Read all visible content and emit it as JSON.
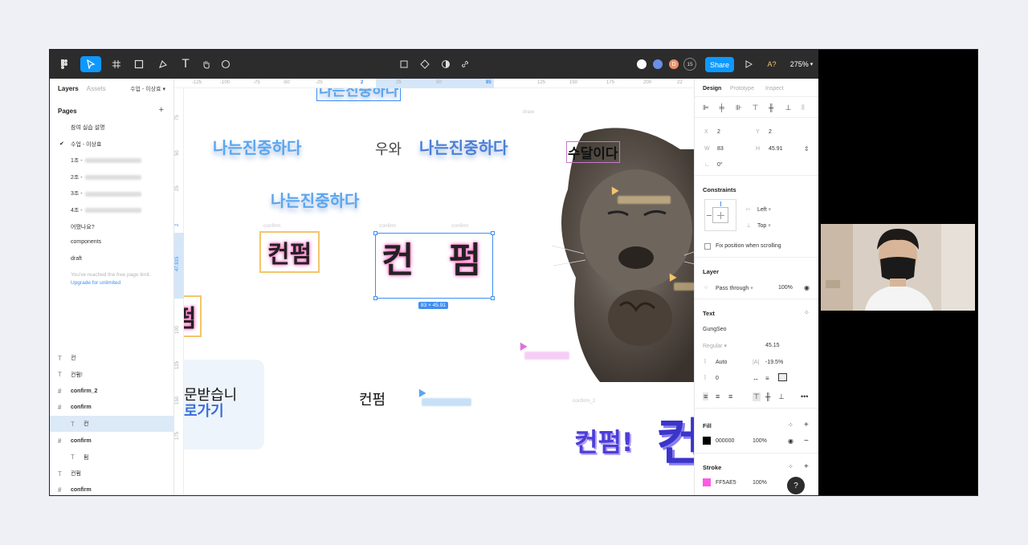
{
  "toolbar": {
    "zoom": "275%",
    "share_label": "Share",
    "ai_label": "A?",
    "collaborator_count": "15",
    "avatar_letter": "D"
  },
  "left_panel": {
    "tab_layers": "Layers",
    "tab_assets": "Assets",
    "current_page": "수업 - 이상효",
    "pages_heading": "Pages",
    "add_icon": "+",
    "pages": [
      {
        "label": "참여 실습 설명",
        "active": false
      },
      {
        "label": "수업 - 이상효",
        "active": true
      },
      {
        "label": "1조 -",
        "active": false
      },
      {
        "label": "2조 -",
        "active": false
      },
      {
        "label": "3조 -",
        "active": false
      },
      {
        "label": "4조 -",
        "active": false
      },
      {
        "label": "어땠나요?",
        "active": false
      },
      {
        "label": "components",
        "active": false
      },
      {
        "label": "draft",
        "active": false
      }
    ],
    "limit_note": "You've reached the free page limit.",
    "upgrade_link": "Upgrade for unlimited",
    "layers": [
      {
        "icon": "T",
        "label": "컨",
        "bold": false,
        "selected": false,
        "indent": false
      },
      {
        "icon": "T",
        "label": "컨펌!",
        "bold": false,
        "selected": false,
        "indent": false
      },
      {
        "icon": "#",
        "label": "confirm_2",
        "bold": true,
        "selected": false,
        "indent": false
      },
      {
        "icon": "#",
        "label": "confirm",
        "bold": true,
        "selected": false,
        "indent": false
      },
      {
        "icon": "T",
        "label": "컨",
        "bold": false,
        "selected": true,
        "indent": true
      },
      {
        "icon": "#",
        "label": "confirm",
        "bold": true,
        "selected": false,
        "indent": false
      },
      {
        "icon": "T",
        "label": "펌",
        "bold": false,
        "selected": false,
        "indent": true
      },
      {
        "icon": "T",
        "label": "컨펌",
        "bold": false,
        "selected": false,
        "indent": false
      },
      {
        "icon": "#",
        "label": "confirm",
        "bold": true,
        "selected": false,
        "indent": false
      }
    ]
  },
  "canvas": {
    "ruler_top": [
      "-125",
      "-100",
      "-75",
      "-50",
      "-25",
      "2",
      "25",
      "50",
      "85",
      "125",
      "150",
      "175",
      "200",
      "22"
    ],
    "ruler_left": [
      "75",
      "50",
      "25",
      "2",
      "47.915",
      "100",
      "125",
      "150",
      "175"
    ],
    "texts": {
      "t1": "나는진중하다",
      "t2": "나는진중하다",
      "t3": "우와",
      "t4": "나는진중하다",
      "t5": "나는진중하다",
      "t6": "수달이다",
      "t7": "컨펌",
      "t8": "컨 펌",
      "t9": "펌",
      "t10": "컨펌",
      "t11": "컨펌!",
      "t12": "컨",
      "t13": "로가기",
      "t14": "문받습니"
    },
    "ghost_labels": [
      "confirm",
      "confirm",
      "confirm",
      "confirm_2",
      "draw"
    ],
    "dimension_tag": "83 × 45.91"
  },
  "right_panel": {
    "tabs": [
      "Design",
      "Prototype",
      "Inspect"
    ],
    "x_label": "X",
    "x": "2",
    "y_label": "Y",
    "y": "2",
    "w_label": "W",
    "w": "83",
    "h_label": "H",
    "h": "45.91",
    "rotation": "0°",
    "constraints_heading": "Constraints",
    "constraint_h": "Left",
    "constraint_v": "Top",
    "fix_position": "Fix position when scrolling",
    "layer_heading": "Layer",
    "blend": "Pass through",
    "layer_opacity": "100%",
    "text_heading": "Text",
    "font_family": "GungSeo",
    "font_weight": "Regular",
    "font_size": "45.15",
    "line_height": "Auto",
    "letter_spacing": "-19.5%",
    "paragraph_spacing": "0",
    "fill_heading": "Fill",
    "fill_hex": "000000",
    "fill_opacity": "100%",
    "stroke_heading": "Stroke",
    "stroke_hex": "FF5AE5",
    "stroke_opacity": "100%",
    "help": "?"
  },
  "colors": {
    "accent": "#0d99ff",
    "toolbar_bg": "#2c2c2c",
    "fill": "#000000",
    "stroke": "#FF5AE5"
  }
}
